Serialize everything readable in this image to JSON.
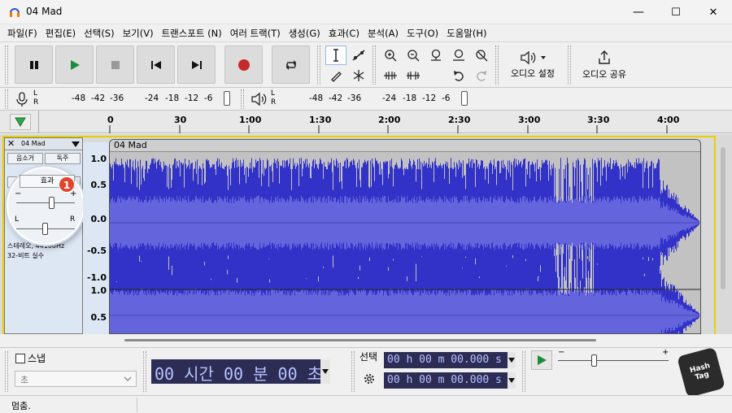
{
  "window": {
    "title": "04 Mad",
    "minimize": "—",
    "maximize": "☐",
    "close": "✕"
  },
  "menu": [
    "파일(F)",
    "편집(E)",
    "선택(S)",
    "보기(V)",
    "트랜스포트 (N)",
    "여러 트랙(T)",
    "생성(G)",
    "효과(C)",
    "분석(A)",
    "도구(O)",
    "도움말(H)"
  ],
  "toolbar": {
    "audio_setup": "오디오 설정",
    "audio_share": "오디오 공유"
  },
  "meters": {
    "record_scale": [
      "-48",
      "-42",
      "-36",
      "-24",
      "-18",
      "-12",
      "-6"
    ],
    "play_scale": [
      "-48",
      "-42",
      "-36",
      "-24",
      "-18",
      "-12",
      "-6"
    ],
    "lr": [
      "L",
      "R"
    ]
  },
  "ruler": {
    "ticks": [
      "0",
      "30",
      "1:00",
      "1:30",
      "2:00",
      "2:30",
      "3:00",
      "3:30",
      "4:00"
    ]
  },
  "track": {
    "name": "04 Mad",
    "mute": "음소거",
    "solo": "독주",
    "effects": "효과",
    "info_line1": "스테레오, 44100Hz",
    "info_line2": "32-비트 실수",
    "badge": "1",
    "gain_minus": "−",
    "gain_plus": "+",
    "pan_l": "L",
    "pan_r": "R",
    "clip_name": "04 Mad",
    "scale_top": [
      "1.0",
      "0.5",
      "0.0",
      "-0.5",
      "-1.0"
    ],
    "scale_bottom": [
      "1.0",
      "0.5"
    ]
  },
  "bottom": {
    "snap_label": "스냅",
    "snap_unit": "초",
    "time_display": "00 시간 00 분 00 초",
    "selection_label": "선택",
    "sel_start": "00 h 00 m 00.000 s",
    "sel_end": "00 h 00 m 00.000 s",
    "speed_minus": "−",
    "speed_plus": "+"
  },
  "status": {
    "text": "멈춤."
  },
  "watermark": {
    "text": "Hash Tag"
  },
  "colors": {
    "waveform": "#3232c8",
    "waveform_rms": "#6464dc",
    "track_bg": "#c2c2c2"
  }
}
